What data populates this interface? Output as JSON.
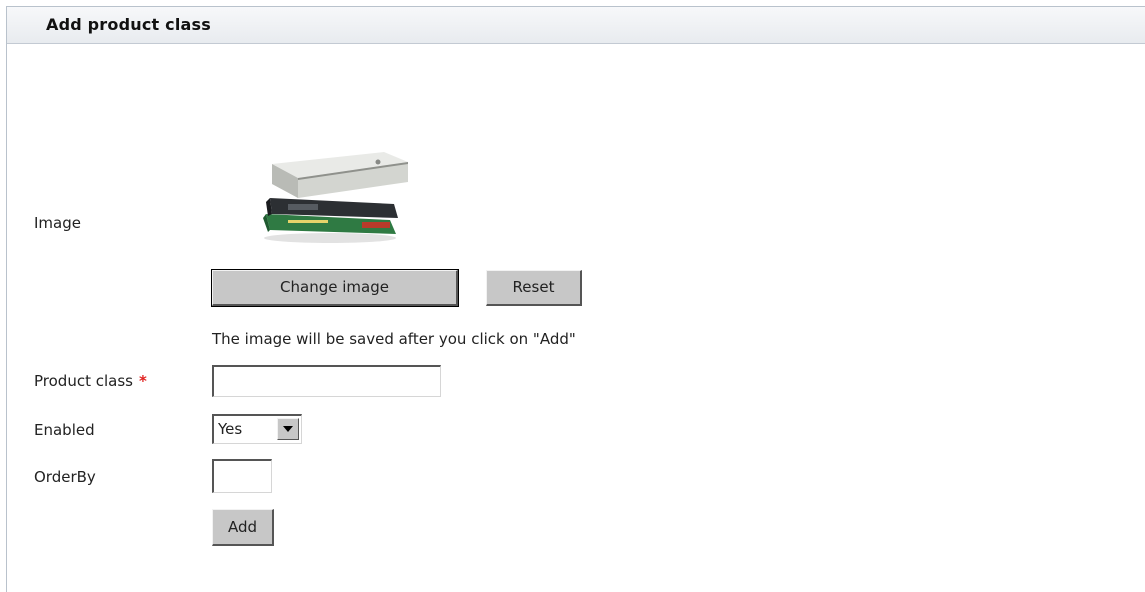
{
  "panel": {
    "title": "Add product class"
  },
  "form": {
    "image": {
      "label": "Image",
      "change_label": "Change image",
      "reset_label": "Reset",
      "hint": "The image will be saved after you click on \"Add\""
    },
    "product_class": {
      "label": "Product class",
      "required_mark": "*",
      "value": ""
    },
    "enabled": {
      "label": "Enabled",
      "selected": "Yes"
    },
    "order_by": {
      "label": "OrderBy",
      "value": ""
    },
    "add_label": "Add"
  },
  "icons": {
    "product_image": "stack-of-books-image",
    "dropdown": "chevron-down-icon"
  },
  "colors": {
    "required": "#e0211f",
    "button_face": "#c7c7c7",
    "header_bg": "#e8ebef"
  }
}
